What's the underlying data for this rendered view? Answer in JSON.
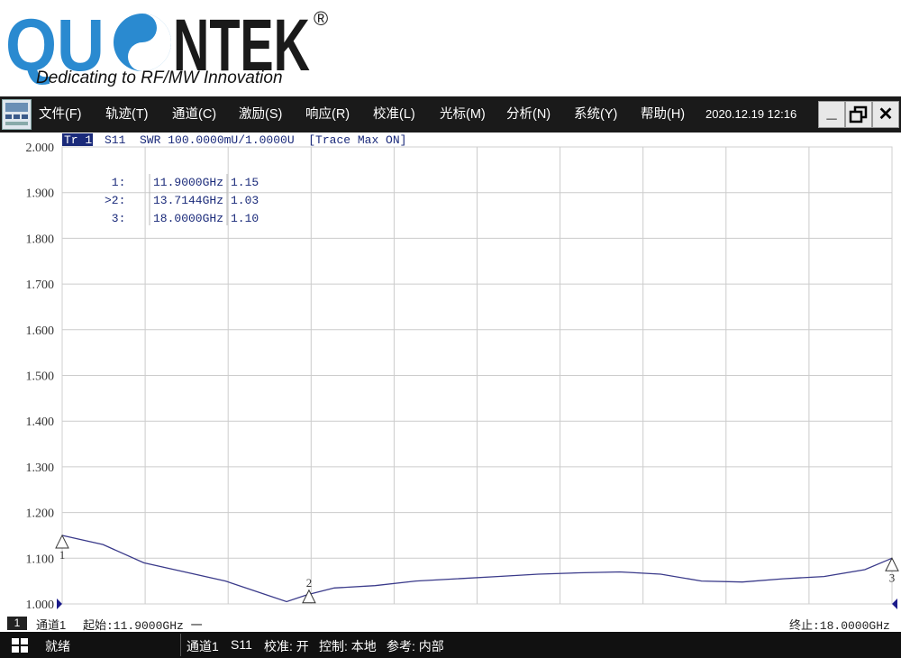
{
  "logo": {
    "brand": "QU●NTEK®",
    "tagline": "Dedicating to RF/MW Innovation",
    "color": "#2a8ad0"
  },
  "menu": {
    "items": [
      "文件(F)",
      "轨迹(T)",
      "通道(C)",
      "激励(S)",
      "响应(R)",
      "校准(L)",
      "光标(M)",
      "分析(N)",
      "系统(Y)",
      "帮助(H)"
    ],
    "datetime": "2020.12.19 12:16",
    "minimize_label": "_",
    "close_label": "✕"
  },
  "trace_header": {
    "tag": "Tr 1",
    "text": "S11  SWR 100.0000mU/1.0000U  [Trace Max ON]"
  },
  "markers": {
    "rows": [
      {
        "label": " 1:",
        "freq": "11.9000GHz",
        "value": "1.15"
      },
      {
        "label": ">2:",
        "freq": "13.7144GHz",
        "value": "1.03"
      },
      {
        "label": " 3:",
        "freq": "18.0000GHz",
        "value": "1.10"
      }
    ]
  },
  "chart_data": {
    "type": "line",
    "ylabels": [
      "2.000",
      "1.900",
      "1.800",
      "1.700",
      "1.600",
      "1.500",
      "1.400",
      "1.300",
      "1.200",
      "1.100",
      "1.000"
    ],
    "ylim": [
      1.0,
      2.0
    ],
    "xlim": [
      11.9,
      18.0
    ],
    "grid": true,
    "trace_color": "#3a3a8a",
    "series": [
      {
        "x": [
          11.9,
          12.2,
          12.5,
          12.8,
          13.1,
          13.4,
          13.55,
          13.7,
          13.9,
          14.2,
          14.5,
          14.8,
          15.1,
          15.4,
          15.7,
          16.0,
          16.3,
          16.6,
          16.9,
          17.2,
          17.5,
          17.8,
          18.0
        ],
        "values": [
          1.15,
          1.13,
          1.09,
          1.07,
          1.05,
          1.02,
          1.005,
          1.02,
          1.035,
          1.04,
          1.05,
          1.055,
          1.06,
          1.065,
          1.068,
          1.07,
          1.065,
          1.05,
          1.048,
          1.055,
          1.06,
          1.075,
          1.1
        ]
      }
    ],
    "markers": [
      {
        "id": "1",
        "x": 11.9,
        "y": 1.15
      },
      {
        "id": "2",
        "x": 13.7144,
        "y": 1.03
      },
      {
        "id": "3",
        "x": 18.0,
        "y": 1.1
      }
    ]
  },
  "footer": {
    "channel_num": "1",
    "channel": "通道1",
    "start": "起始:11.9000GHz 一",
    "stop": "终止:18.0000GHz"
  },
  "status": {
    "ready": "就绪",
    "channel": "通道1",
    "param": "S11",
    "cal": "校准: 开",
    "control": "控制: 本地",
    "ref": "参考: 内部"
  }
}
